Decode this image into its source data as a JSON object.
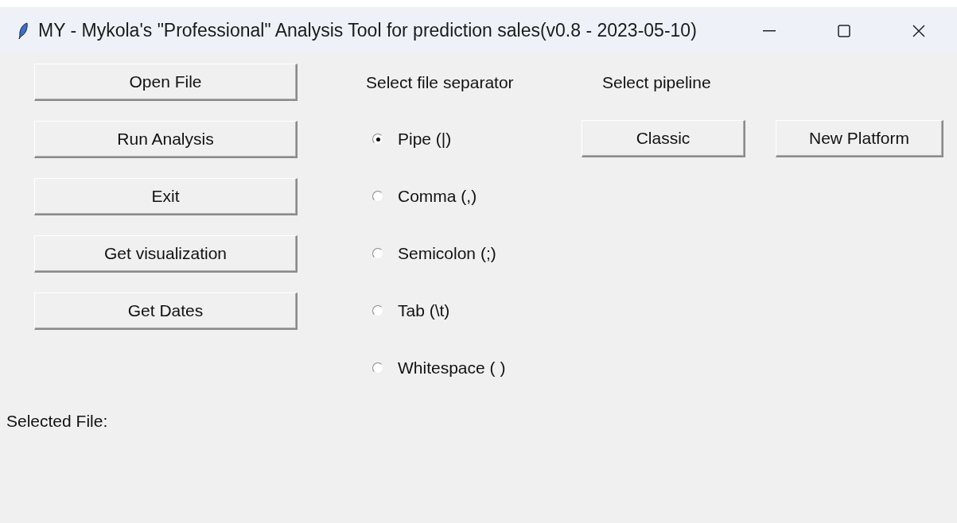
{
  "window": {
    "title": "MY - Mykola's \"Professional\" Analysis Tool for prediction sales(v0.8 - 2023-05-10)"
  },
  "actions": [
    "Open File",
    "Run Analysis",
    "Exit",
    "Get visualization",
    "Get Dates"
  ],
  "separator": {
    "label": "Select file separator",
    "options": [
      {
        "label": "Pipe (|)",
        "selected": true
      },
      {
        "label": "Comma (,)",
        "selected": false
      },
      {
        "label": "Semicolon (;)",
        "selected": false
      },
      {
        "label": "Tab (\\t)",
        "selected": false
      },
      {
        "label": "Whitespace ( )",
        "selected": false
      }
    ]
  },
  "pipeline": {
    "label": "Select pipeline",
    "buttons": [
      "Classic",
      "New Platform"
    ]
  },
  "selected_file": {
    "label": "Selected File:"
  }
}
